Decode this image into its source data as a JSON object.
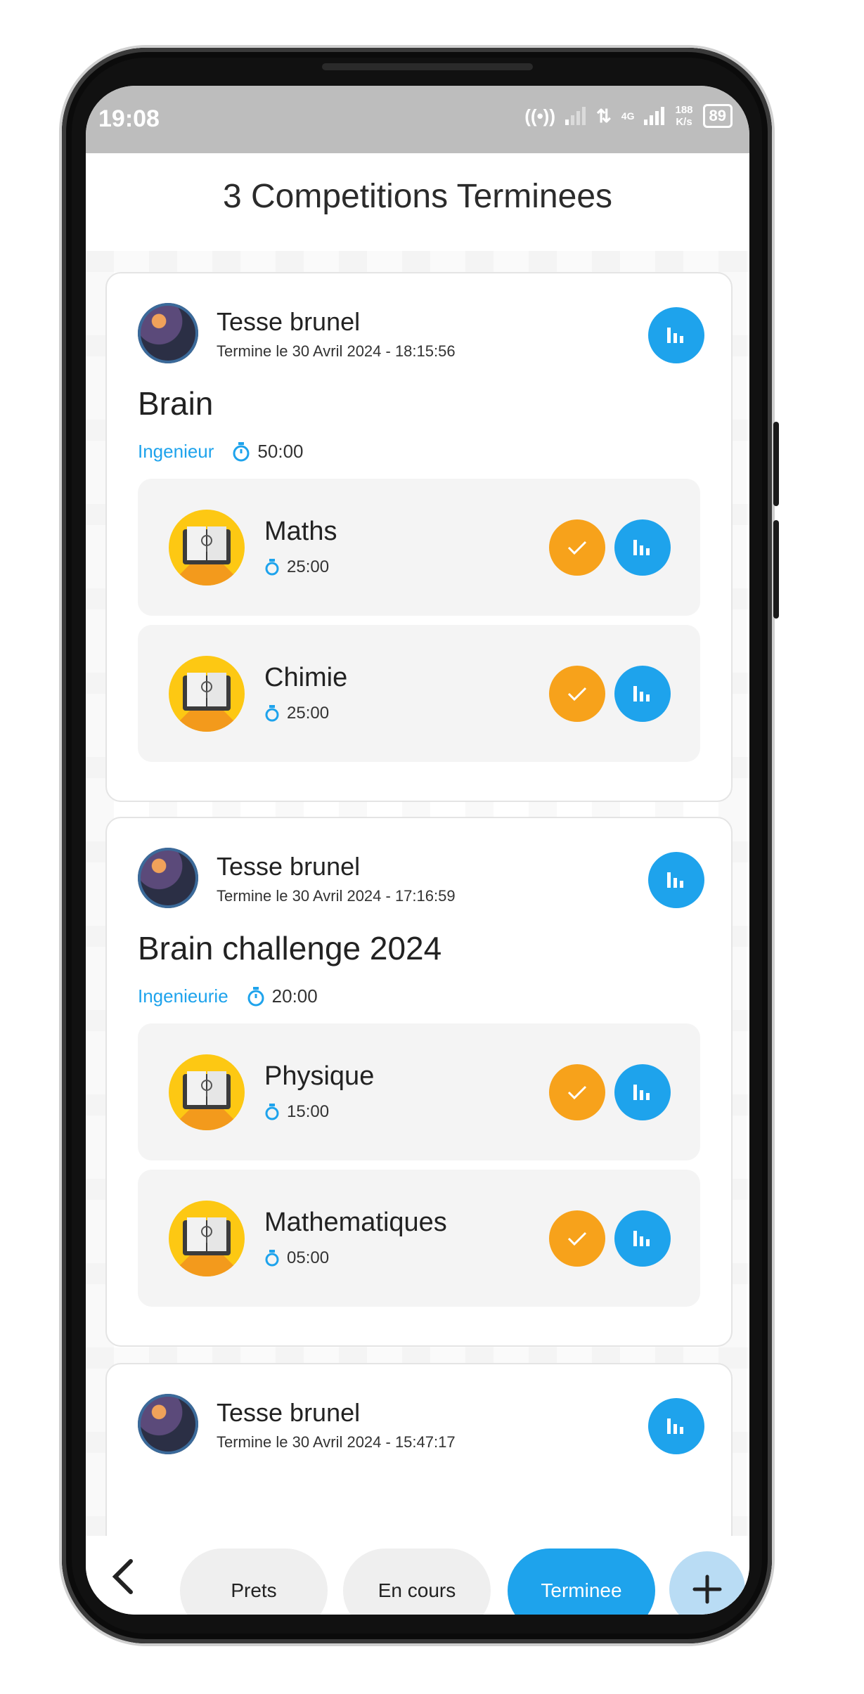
{
  "status": {
    "time": "19:08",
    "network": "4G",
    "speed_value": "188",
    "speed_unit": "K/s",
    "battery": "89"
  },
  "page": {
    "title": "3 Competitions Terminees"
  },
  "competitions": [
    {
      "author": "Tesse brunel",
      "finished": "Termine le 30 Avril 2024 - 18:15:56",
      "title": "Brain",
      "category": "Ingenieur",
      "duration": "50:00",
      "subjects": [
        {
          "name": "Maths",
          "duration": "25:00"
        },
        {
          "name": "Chimie",
          "duration": "25:00"
        }
      ]
    },
    {
      "author": "Tesse brunel",
      "finished": "Termine le 30 Avril 2024 - 17:16:59",
      "title": "Brain challenge 2024",
      "category": "Ingenieurie",
      "duration": "20:00",
      "subjects": [
        {
          "name": "Physique",
          "duration": "15:00"
        },
        {
          "name": "Mathematiques",
          "duration": "05:00"
        }
      ]
    },
    {
      "author": "Tesse brunel",
      "finished": "Termine le 30 Avril 2024 - 15:47:17"
    }
  ],
  "tabs": {
    "ready": "Prets",
    "ongoing": "En cours",
    "finished": "Terminee"
  },
  "colors": {
    "accent": "#1ea3ec",
    "check": "#f7a21b",
    "book": "#fdc813"
  },
  "icons": [
    "back-chevron-icon",
    "stats-icon",
    "check-icon",
    "timer-icon",
    "book-icon",
    "plus-icon"
  ]
}
